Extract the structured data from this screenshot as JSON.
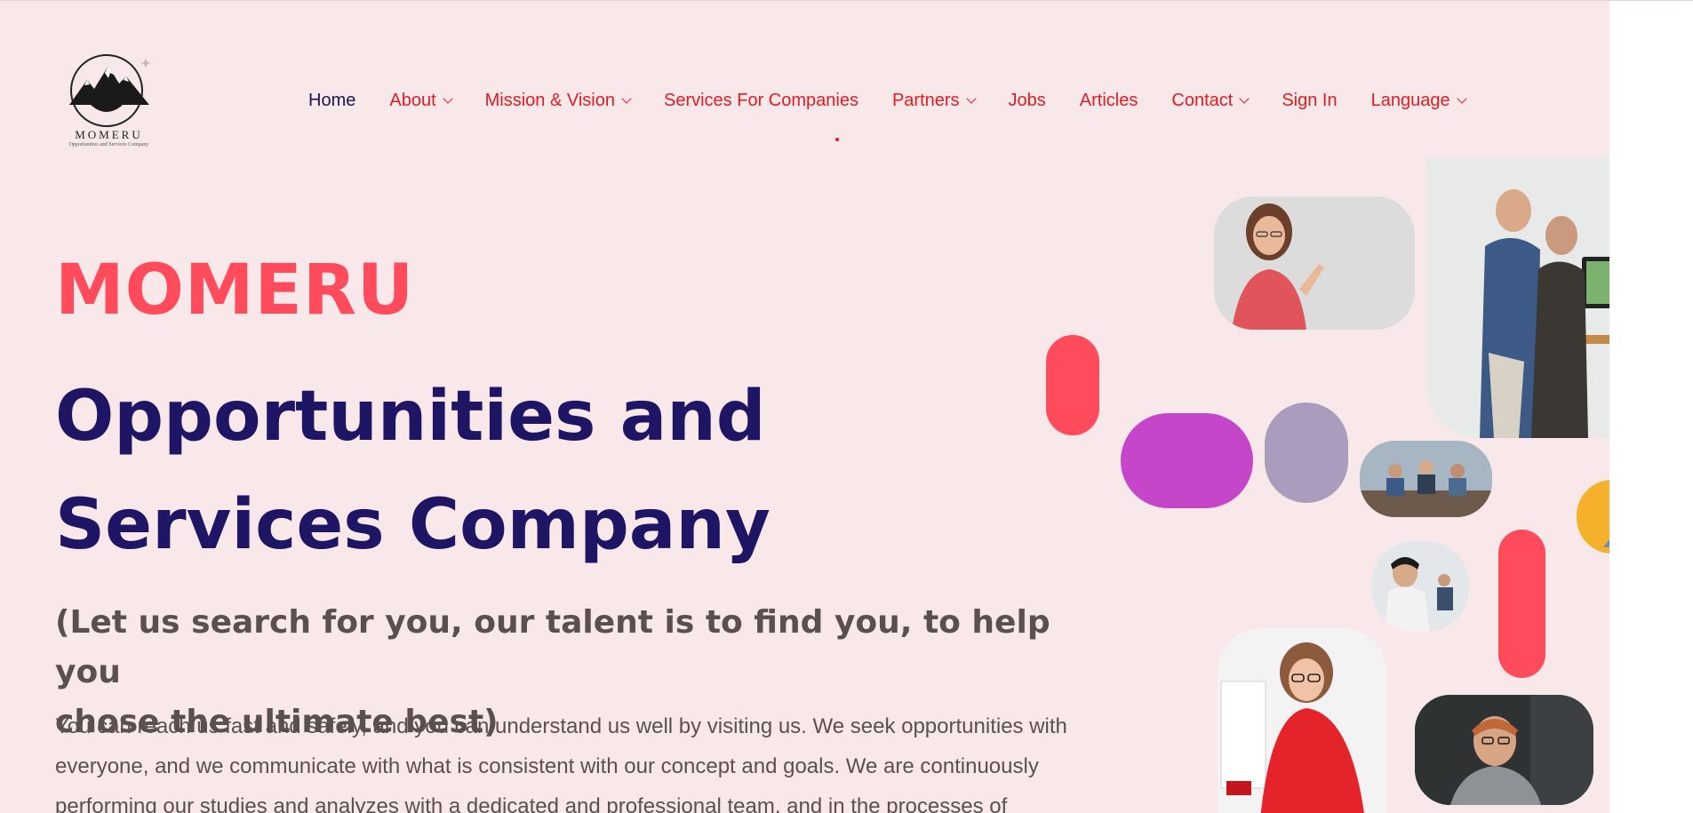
{
  "logo": {
    "word": "MOMERU",
    "tagline": "Opportunities and Services Company"
  },
  "nav": {
    "items": [
      {
        "label": "Home",
        "has_dropdown": false,
        "active": true
      },
      {
        "label": "About",
        "has_dropdown": true
      },
      {
        "label": "Mission & Vision",
        "has_dropdown": true
      },
      {
        "label": "Services For Companies",
        "has_dropdown": false
      },
      {
        "label": "Partners",
        "has_dropdown": true
      },
      {
        "label": "Jobs",
        "has_dropdown": false
      },
      {
        "label": "Articles",
        "has_dropdown": false
      },
      {
        "label": "Contact",
        "has_dropdown": true
      },
      {
        "label": "Sign In",
        "has_dropdown": false
      },
      {
        "label": "Language",
        "has_dropdown": true
      }
    ]
  },
  "hero": {
    "brand": "MOMERU",
    "title_line1": "Opportunities and",
    "title_line2": "Services Company",
    "subtitle_line1": "(Let us search for you, our talent is to find you, to help you",
    "subtitle_line2": "chose the ultimate best)",
    "body_line1": "You can reach us fast and safely, and you can understand us well by visiting us. We seek opportunities with",
    "body_line2": "everyone, and we communicate with what is consistent with our concept and goals. We are continuously",
    "body_line3": "performing our studies and analyzes with a dedicated and professional team, and in the processes of"
  },
  "colors": {
    "background": "#f9e8ea",
    "accent_red": "#ff4b5c",
    "nav_red": "#e01c20",
    "navy": "#1e1664",
    "magenta": "#c546c8",
    "lavender": "#ab9bbd",
    "amber": "#f5b12b"
  },
  "icons": {
    "dropdown": "chevron-down-icon",
    "logo": "mountain-logo-icon"
  }
}
